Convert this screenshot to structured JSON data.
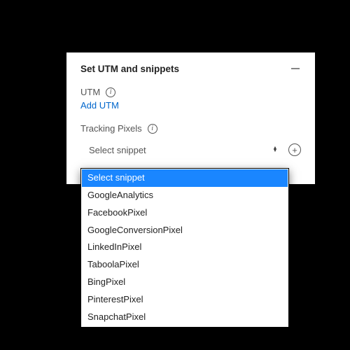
{
  "panel": {
    "title": "Set UTM and snippets",
    "utm": {
      "label": "UTM",
      "addLink": "Add UTM"
    },
    "tracking": {
      "label": "Tracking Pixels",
      "selectPlaceholder": "Select snippet"
    }
  },
  "dropdown": {
    "items": [
      "Select snippet",
      "GoogleAnalytics",
      "FacebookPixel",
      "GoogleConversionPixel",
      "LinkedInPixel",
      "TaboolaPixel",
      "BingPixel",
      "PinterestPixel",
      "SnapchatPixel"
    ],
    "selectedIndex": 0
  }
}
